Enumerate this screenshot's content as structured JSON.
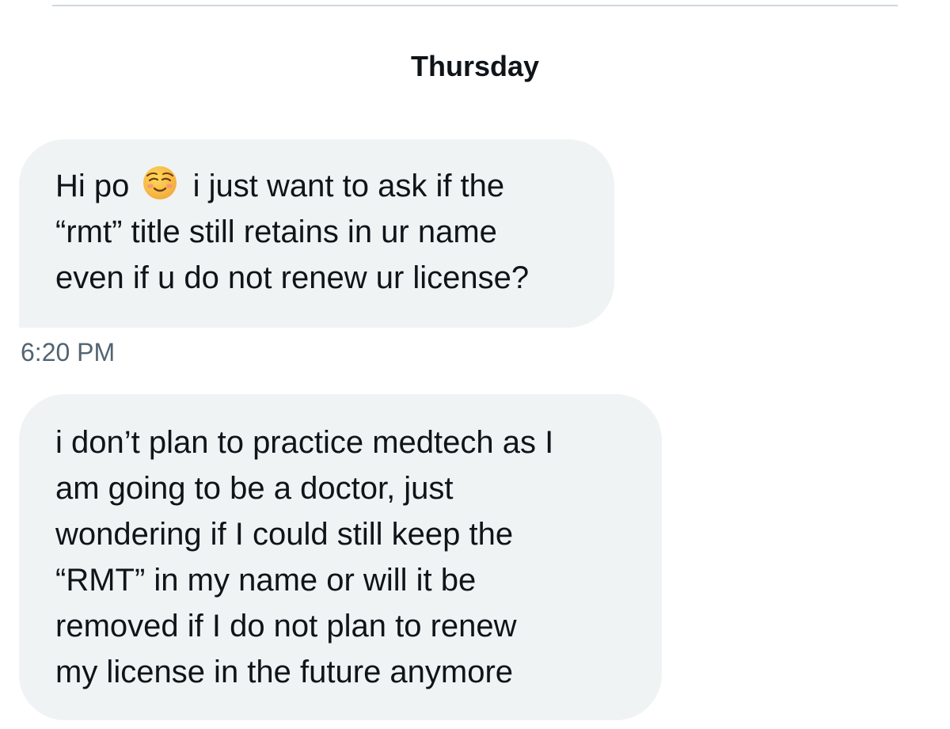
{
  "conversation": {
    "day_separator": "Thursday",
    "messages": [
      {
        "lines": {
          "l1_before": "Hi po",
          "l1_after": "i just want to ask if the",
          "l2": "“rmt” title still retains in ur name",
          "l3": "even if u do not renew ur license?"
        },
        "emoji": "relieved-face-icon",
        "timestamp": "6:20 PM"
      },
      {
        "lines": {
          "l1": "i don’t plan to practice medtech as I",
          "l2": "am going to be a doctor,  just",
          "l3": "wondering if I could still keep the",
          "l4": "“RMT” in my name or will it be",
          "l5": "removed if I do not plan to renew",
          "l6": "my license in the future anymore"
        }
      }
    ]
  },
  "colors": {
    "bubble_background": "#eff3f4",
    "text_primary": "#0f1419",
    "text_secondary": "#536471",
    "divider": "#cfd9de",
    "emoji_face": "#f9c13c"
  }
}
